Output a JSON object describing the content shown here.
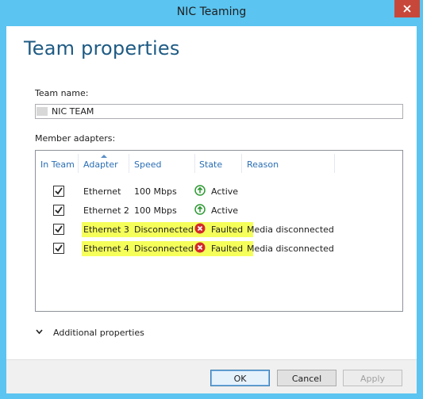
{
  "window": {
    "title": "NIC Teaming"
  },
  "page": {
    "heading": "Team properties"
  },
  "team": {
    "label": "Team name:",
    "value": "NIC TEAM"
  },
  "members": {
    "label": "Member adapters:",
    "columns": [
      "In Team",
      "Adapter",
      "Speed",
      "State",
      "Reason"
    ],
    "rows": [
      {
        "in_team": true,
        "adapter": "Ethernet",
        "speed": "100 Mbps",
        "state": "Active",
        "state_icon": "green-up-arrow-icon",
        "reason": ""
      },
      {
        "in_team": true,
        "adapter": "Ethernet 2",
        "speed": "100 Mbps",
        "state": "Active",
        "state_icon": "green-up-arrow-icon",
        "reason": ""
      },
      {
        "in_team": true,
        "adapter": "Ethernet 3",
        "speed": "Disconnected",
        "state": "Faulted",
        "state_icon": "red-x-icon",
        "reason": "Media disconnected",
        "highlighted": true
      },
      {
        "in_team": true,
        "adapter": "Ethernet 4",
        "speed": "Disconnected",
        "state": "Faulted",
        "state_icon": "red-x-icon",
        "reason": "Media disconnected",
        "highlighted": true
      }
    ]
  },
  "additional": {
    "label": "Additional properties"
  },
  "buttons": {
    "ok": "OK",
    "cancel": "Cancel",
    "apply": "Apply"
  },
  "colors": {
    "accent": "#5bc4f0",
    "heading": "#1f5b84",
    "highlight": "#f5ff5a",
    "active_green": "#2e9a33",
    "fault_red": "#d42a2a"
  }
}
